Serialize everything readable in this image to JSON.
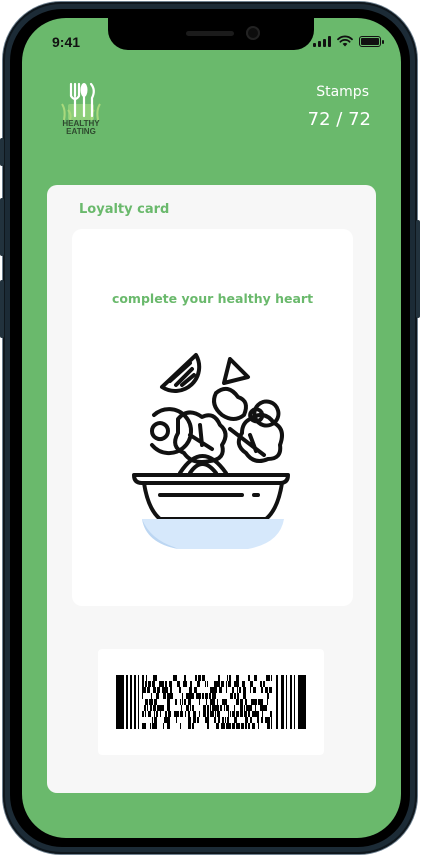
{
  "status_bar": {
    "time": "9:41",
    "icons": [
      "cellular-signal-icon",
      "wifi-icon",
      "battery-icon"
    ]
  },
  "header": {
    "logo_line1": "HEALTHY",
    "logo_line2": "EATING",
    "stamps_label": "Stamps",
    "stamps_value": "72 / 72"
  },
  "card": {
    "title": "Loyalty card",
    "message": "complete your healthy heart",
    "illustration": "salad-bowl-icon",
    "barcode": "barcode-icon"
  },
  "colors": {
    "accent": "#6ab96c",
    "card_background": "#f7f7f7",
    "bowl_fill": "#d6e8fb"
  }
}
